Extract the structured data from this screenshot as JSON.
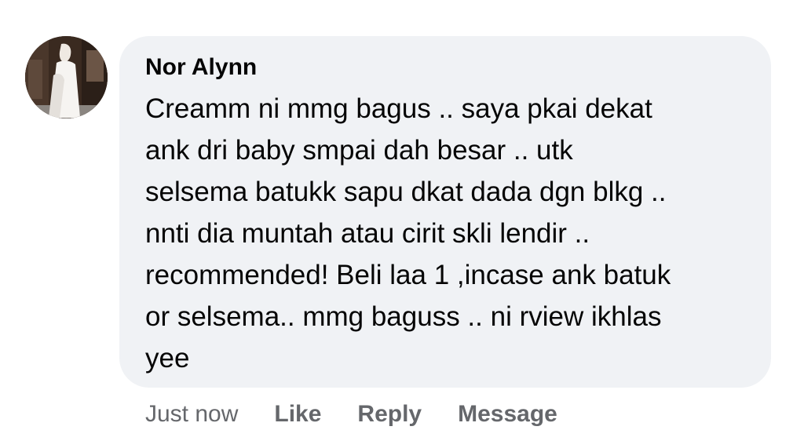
{
  "comment": {
    "author": "Nor Alynn",
    "text": "Creamm ni mmg bagus .. saya pkai dekat\nank dri baby smpai dah besar .. utk\nselsema batukk sapu dkat dada dgn blkg ..\nnnti dia muntah atau cirit skli lendir ..\nrecommended! Beli laa 1 ,incase ank batuk\nor selsema.. mmg baguss .. ni rview ikhlas\nyee",
    "timestamp": "Just now"
  },
  "actions": {
    "like_label": "Like",
    "reply_label": "Reply",
    "message_label": "Message"
  },
  "colors": {
    "bubble_bg": "#f0f2f5",
    "text": "#050505",
    "secondary_text": "#65676b"
  }
}
